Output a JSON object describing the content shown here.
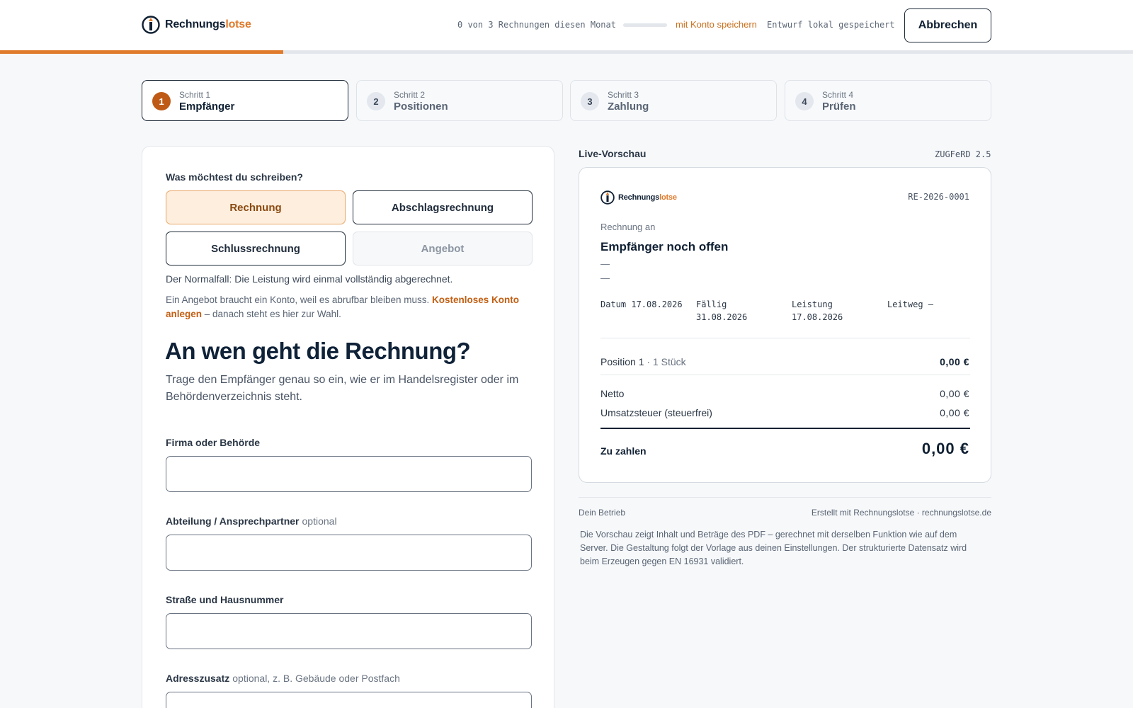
{
  "header": {
    "logo": {
      "part1": "Rechnungs",
      "part2": "lotse"
    },
    "quota_text": "0 von 3 Rechnungen diesen Monat",
    "save_link": "mit Konto speichern",
    "draft_status": "Entwurf lokal gespeichert",
    "cancel_label": "Abbrechen"
  },
  "steps": [
    {
      "num": "1",
      "small": "Schritt 1",
      "label": "Empfänger"
    },
    {
      "num": "2",
      "small": "Schritt 2",
      "label": "Positionen"
    },
    {
      "num": "3",
      "small": "Schritt 3",
      "label": "Zahlung"
    },
    {
      "num": "4",
      "small": "Schritt 4",
      "label": "Prüfen"
    }
  ],
  "form": {
    "question": "Was möchtest du schreiben?",
    "types": {
      "rechnung": "Rechnung",
      "abschlag": "Abschlagsrechnung",
      "schluss": "Schlussrechnung",
      "angebot": "Angebot"
    },
    "hint_normal": "Der Normalfall: Die Leistung wird einmal vollständig abgerechnet.",
    "hint_angebot_pre": "Ein Angebot braucht ein Konto, weil es abrufbar bleiben muss.",
    "hint_angebot_link": "Kostenloses Konto anlegen",
    "hint_angebot_post": "– danach steht es hier zur Wahl.",
    "title": "An wen geht die Rechnung?",
    "subtitle": "Trage den Empfänger genau so ein, wie er im Handelsregister oder im Behördenverzeichnis steht.",
    "fields": {
      "firma": {
        "label": "Firma oder Behörde",
        "optional": "",
        "value": ""
      },
      "abteilung": {
        "label": "Abteilung / Ansprechpartner",
        "optional": "optional",
        "value": ""
      },
      "strasse": {
        "label": "Straße und Hausnummer",
        "optional": "",
        "value": ""
      },
      "adresszusatz": {
        "label": "Adresszusatz",
        "optional": "optional, z. B. Gebäude oder Postfach",
        "value": ""
      }
    }
  },
  "preview": {
    "label": "Live-Vorschau",
    "format": "ZUGFeRD 2.5",
    "invoice_number": "RE-2026-0001",
    "recipient_label": "Rechnung an",
    "recipient_name": "Empfänger noch offen",
    "dash1": "—",
    "dash2": "—",
    "meta": {
      "datum": "Datum 17.08.2026",
      "faellig_label": "Fällig",
      "faellig_value": "31.08.2026",
      "leistung_label": "Leistung",
      "leistung_value": "17.08.2026",
      "leitweg": "Leitweg —"
    },
    "position_name": "Position 1",
    "position_qty": "· 1 Stück",
    "position_amount": "0,00 €",
    "netto_label": "Netto",
    "netto_value": "0,00 €",
    "ust_label": "Umsatzsteuer (steuerfrei)",
    "ust_value": "0,00 €",
    "total_label": "Zu zahlen",
    "total_value": "0,00 €",
    "footer_left": "Dein Betrieb",
    "footer_right": "Erstellt mit Rechnungslotse · rechnungslotse.de",
    "note": "Die Vorschau zeigt Inhalt und Beträge des PDF – gerechnet mit derselben Funktion wie auf dem Server. Die Gestaltung folgt der Vorlage aus deinen Einstellungen. Der strukturierte Datensatz wird beim Erzeugen gegen EN 16931 validiert."
  },
  "progress": {
    "completed_fraction": 0.25
  },
  "colors": {
    "accent": "#e07b2c",
    "accent_dark": "#bf5a16",
    "navy": "#102033",
    "selected_bg": "#fdeedd"
  }
}
